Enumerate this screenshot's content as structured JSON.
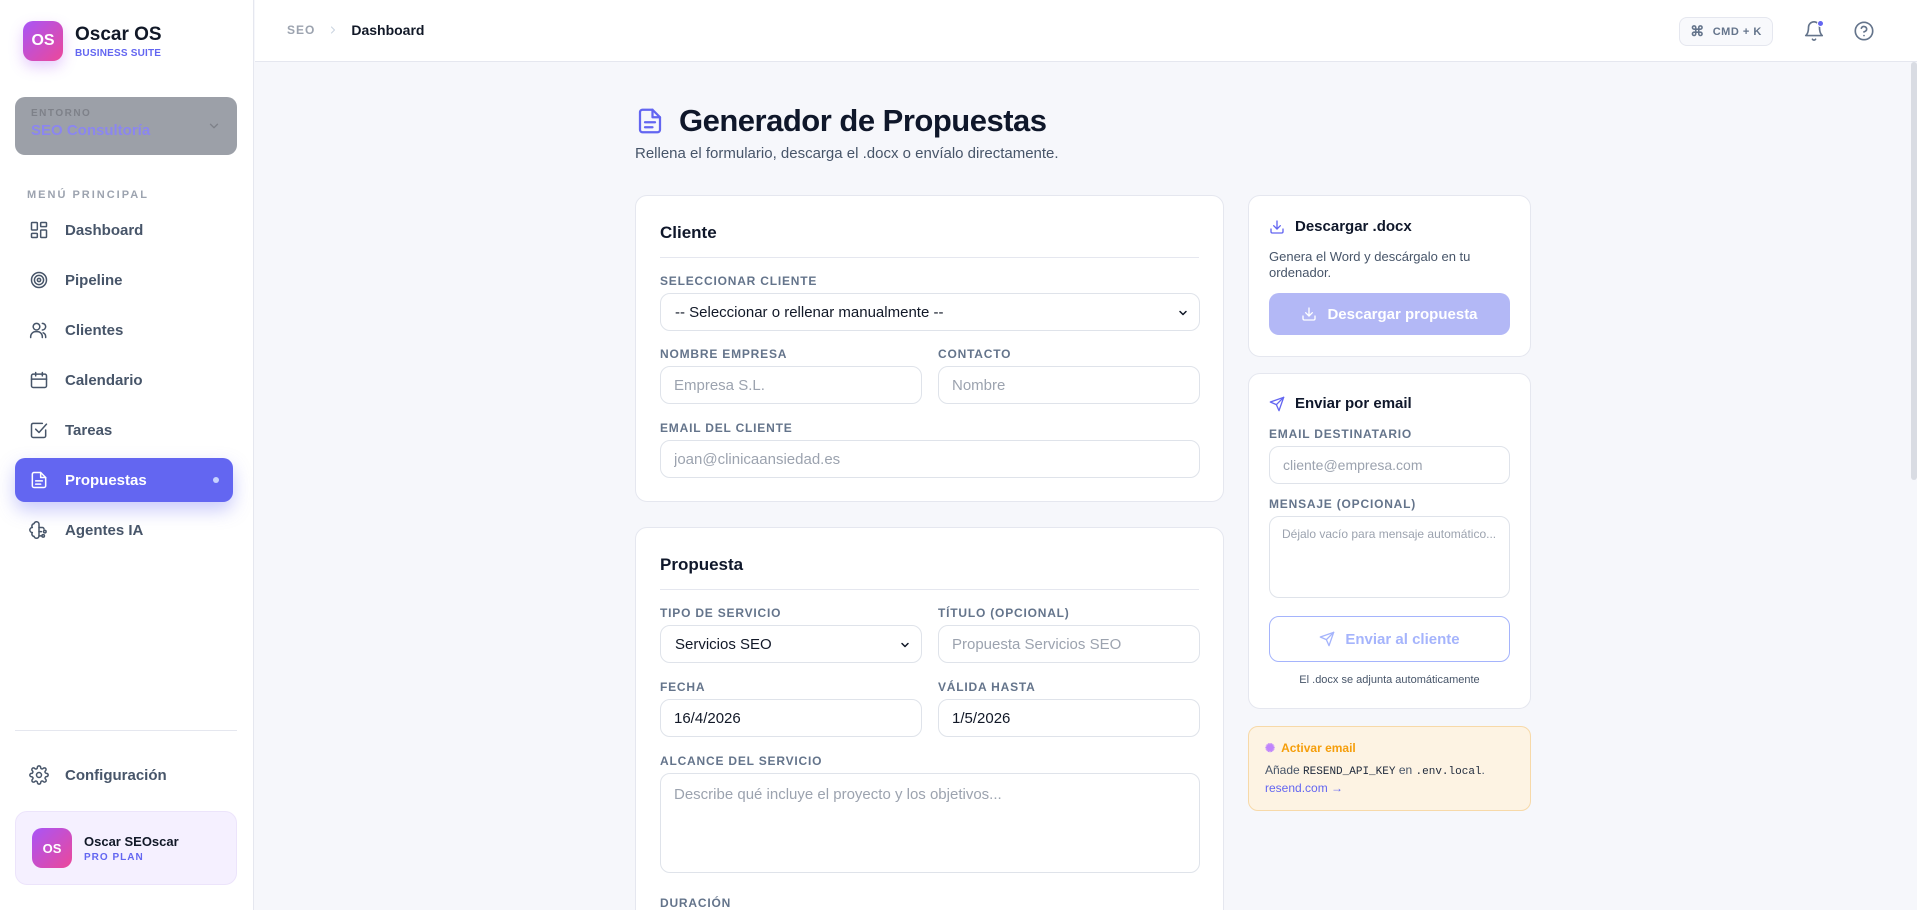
{
  "brand": {
    "logo": "OS",
    "name": "Oscar OS",
    "subtitle": "BUSINESS SUITE"
  },
  "environment": {
    "label": "ENTORNO",
    "value": "SEO Consultoría"
  },
  "nav": {
    "heading": "MENÚ PRINCIPAL",
    "items": [
      {
        "label": "Dashboard",
        "icon": "dashboard-icon"
      },
      {
        "label": "Pipeline",
        "icon": "target-icon"
      },
      {
        "label": "Clientes",
        "icon": "users-icon"
      },
      {
        "label": "Calendario",
        "icon": "calendar-icon"
      },
      {
        "label": "Tareas",
        "icon": "checkbox-icon"
      },
      {
        "label": "Propuestas",
        "icon": "document-icon",
        "active": true
      },
      {
        "label": "Agentes IA",
        "icon": "brain-icon"
      }
    ],
    "config_label": "Configuración"
  },
  "user": {
    "initials": "OS",
    "name": "Oscar SEOscar",
    "plan": "PRO PLAN"
  },
  "topbar": {
    "breadcrumb_root": "SEO",
    "breadcrumb_current": "Dashboard",
    "shortcut_glyph": "⌘",
    "shortcut_label": "CMD + K"
  },
  "page": {
    "title": "Generador de Propuestas",
    "subtitle": "Rellena el formulario, descarga el .docx o envíalo directamente."
  },
  "client_card": {
    "title": "Cliente",
    "select_label": "SELECCIONAR CLIENTE",
    "select_value": "-- Seleccionar o rellenar manualmente --",
    "company_label": "NOMBRE EMPRESA",
    "company_placeholder": "Empresa S.L.",
    "contact_label": "CONTACTO",
    "contact_placeholder": "Nombre",
    "email_label": "EMAIL DEL CLIENTE",
    "email_placeholder": "joan@clinicaansiedad.es"
  },
  "proposal_card": {
    "title": "Propuesta",
    "service_label": "TIPO DE SERVICIO",
    "service_value": "Servicios SEO",
    "title_label": "TÍTULO (OPCIONAL)",
    "title_placeholder": "Propuesta Servicios SEO",
    "date_label": "FECHA",
    "date_value": "16/4/2026",
    "valid_label": "VÁLIDA HASTA",
    "valid_value": "1/5/2026",
    "scope_label": "ALCANCE DEL SERVICIO",
    "scope_placeholder": "Describe qué incluye el proyecto y los objetivos...",
    "duration_label": "DURACIÓN"
  },
  "download_card": {
    "title": "Descargar .docx",
    "description": "Genera el Word y descárgalo en tu ordenador.",
    "button_label": "Descargar propuesta"
  },
  "email_card": {
    "title": "Enviar por email",
    "recipient_label": "EMAIL DESTINATARIO",
    "recipient_placeholder": "cliente@empresa.com",
    "message_label": "MENSAJE (OPCIONAL)",
    "message_placeholder": "Déjalo vacío para mensaje automático...",
    "button_label": "Enviar al cliente",
    "note": "El .docx se adjunta automáticamente"
  },
  "notice": {
    "title": "Activar email",
    "body_prefix": "Añade",
    "body_key": "RESEND_API_KEY",
    "body_mid": "en",
    "body_file": ".env.local",
    "body_suffix": ".",
    "link": "resend.com →"
  },
  "colors": {
    "accent": "#6366f1",
    "brand_gradient_start": "#a855f7",
    "brand_gradient_end": "#ec4899",
    "warning": "#f59e0b"
  }
}
